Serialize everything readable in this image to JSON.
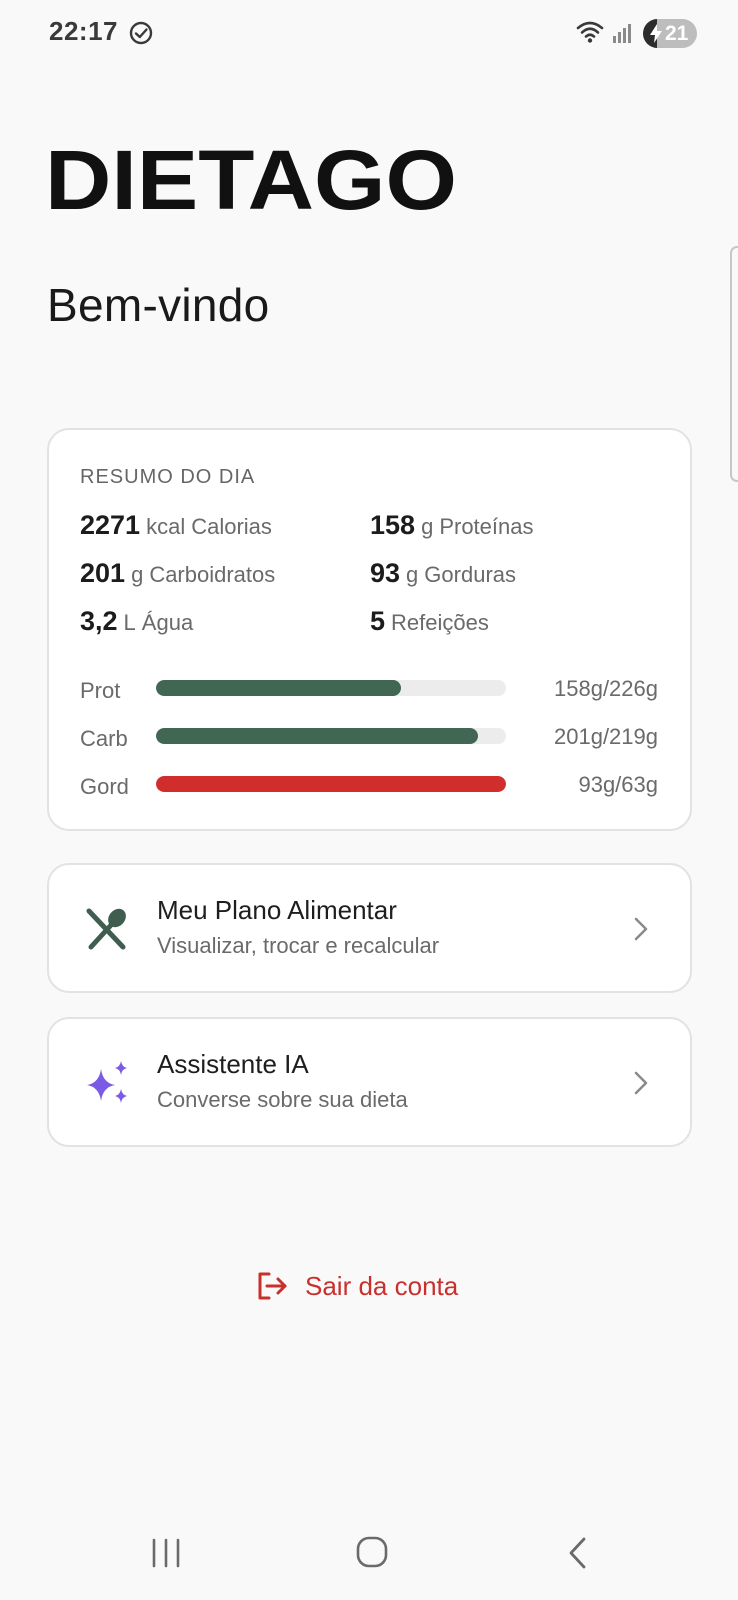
{
  "status_bar": {
    "time": "22:17",
    "battery_level": "21",
    "icons": [
      "check-circle-icon",
      "wifi-icon",
      "signal-icon",
      "battery-charging-icon"
    ]
  },
  "logo_text": "DIETAGO",
  "welcome": "Bem-vindo",
  "summary": {
    "title": "RESUMO DO DIA",
    "stats": [
      {
        "value": "2271",
        "unit": "kcal",
        "label": "Calorias"
      },
      {
        "value": "158",
        "unit": "g",
        "label": "Proteínas"
      },
      {
        "value": "201",
        "unit": "g",
        "label": "Carboidratos"
      },
      {
        "value": "93",
        "unit": "g",
        "label": "Gorduras"
      },
      {
        "value": "3,2",
        "unit": "L",
        "label": "Água"
      },
      {
        "value": "5",
        "unit": "",
        "label": "Refeições"
      }
    ],
    "macros": [
      {
        "label": "Prot",
        "value": "158g/226g",
        "progress": 0.7,
        "color": "#426654"
      },
      {
        "label": "Carb",
        "value": "201g/219g",
        "progress": 0.92,
        "color": "#426654"
      },
      {
        "label": "Gord",
        "value": "93g/63g",
        "progress": 1.0,
        "color": "#d22d2d"
      }
    ]
  },
  "menu": [
    {
      "title": "Meu Plano Alimentar",
      "subtitle": "Visualizar, trocar e recalcular",
      "icon": "fork-spoon-icon",
      "icon_color": "#3f5e50"
    },
    {
      "title": "Assistente IA",
      "subtitle": "Converse sobre sua dieta",
      "icon": "sparkles-icon",
      "icon_color": "#7b5be6"
    }
  ],
  "logout": {
    "label": "Sair da conta",
    "color": "#c9302c"
  },
  "colors": {
    "background": "#f9f9f9",
    "card": "#ffffff",
    "accent_green": "#426654",
    "danger": "#d22d2d"
  }
}
